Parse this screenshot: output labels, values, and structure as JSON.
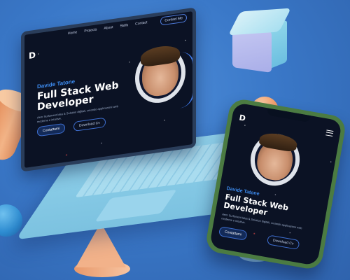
{
  "site": {
    "nav": [
      "Home",
      "Projects",
      "About",
      "Skills",
      "Contact"
    ],
    "contact_button": "Contact Me",
    "logo_letter": "D",
    "name": "Davide Tatone",
    "title": "Full Stack Web Developer",
    "description": "Aenr Surfoment Idea & Solution digitali, creando applicazioni web moderne e intuitive.",
    "primary_button": "Contattami",
    "secondary_button": "Download Cv"
  },
  "colors": {
    "background": "#3a78c8",
    "screen": "#0b1224",
    "accent": "#3d8cf0",
    "laptop_body": "#8fd0ea",
    "phone_frame": "#4b7b42"
  }
}
